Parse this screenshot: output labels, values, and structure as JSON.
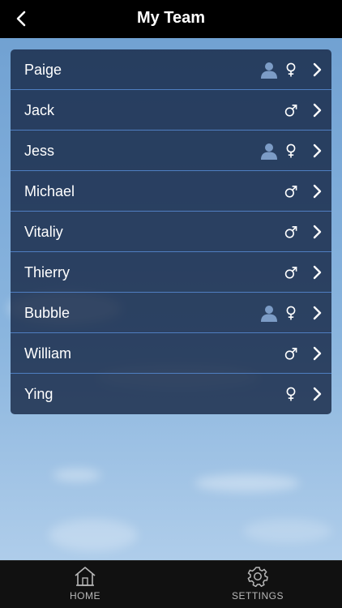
{
  "header": {
    "title": "My Team"
  },
  "team": [
    {
      "name": "Paige",
      "gender": "female",
      "gender_symbol": "♀",
      "has_avatar": true
    },
    {
      "name": "Jack",
      "gender": "male",
      "gender_symbol": "♂",
      "has_avatar": false
    },
    {
      "name": "Jess",
      "gender": "female",
      "gender_symbol": "♀",
      "has_avatar": true
    },
    {
      "name": "Michael",
      "gender": "male",
      "gender_symbol": "♂",
      "has_avatar": false
    },
    {
      "name": "Vitaliy",
      "gender": "male",
      "gender_symbol": "♂",
      "has_avatar": false
    },
    {
      "name": "Thierry",
      "gender": "male",
      "gender_symbol": "♂",
      "has_avatar": false
    },
    {
      "name": "Bubble",
      "gender": "female",
      "gender_symbol": "♀",
      "has_avatar": true
    },
    {
      "name": "William",
      "gender": "male",
      "gender_symbol": "♂",
      "has_avatar": false
    },
    {
      "name": "Ying",
      "gender": "female",
      "gender_symbol": "♀",
      "has_avatar": false
    }
  ],
  "tabbar": {
    "home_label": "HOME",
    "settings_label": "SETTINGS"
  },
  "icons": {
    "back": "chevron-left-icon",
    "person": "person-icon",
    "female": "female-symbol-icon",
    "male": "male-symbol-icon",
    "row_arrow": "chevron-right-icon",
    "home": "home-icon",
    "settings": "gear-icon"
  },
  "colors": {
    "topbar": "#000000",
    "list_background": "#142442",
    "separator": "#4f7ec1",
    "text": "#ffffff",
    "avatar_icon": "#7c9cc6",
    "tab_text": "#b8b8b8"
  }
}
